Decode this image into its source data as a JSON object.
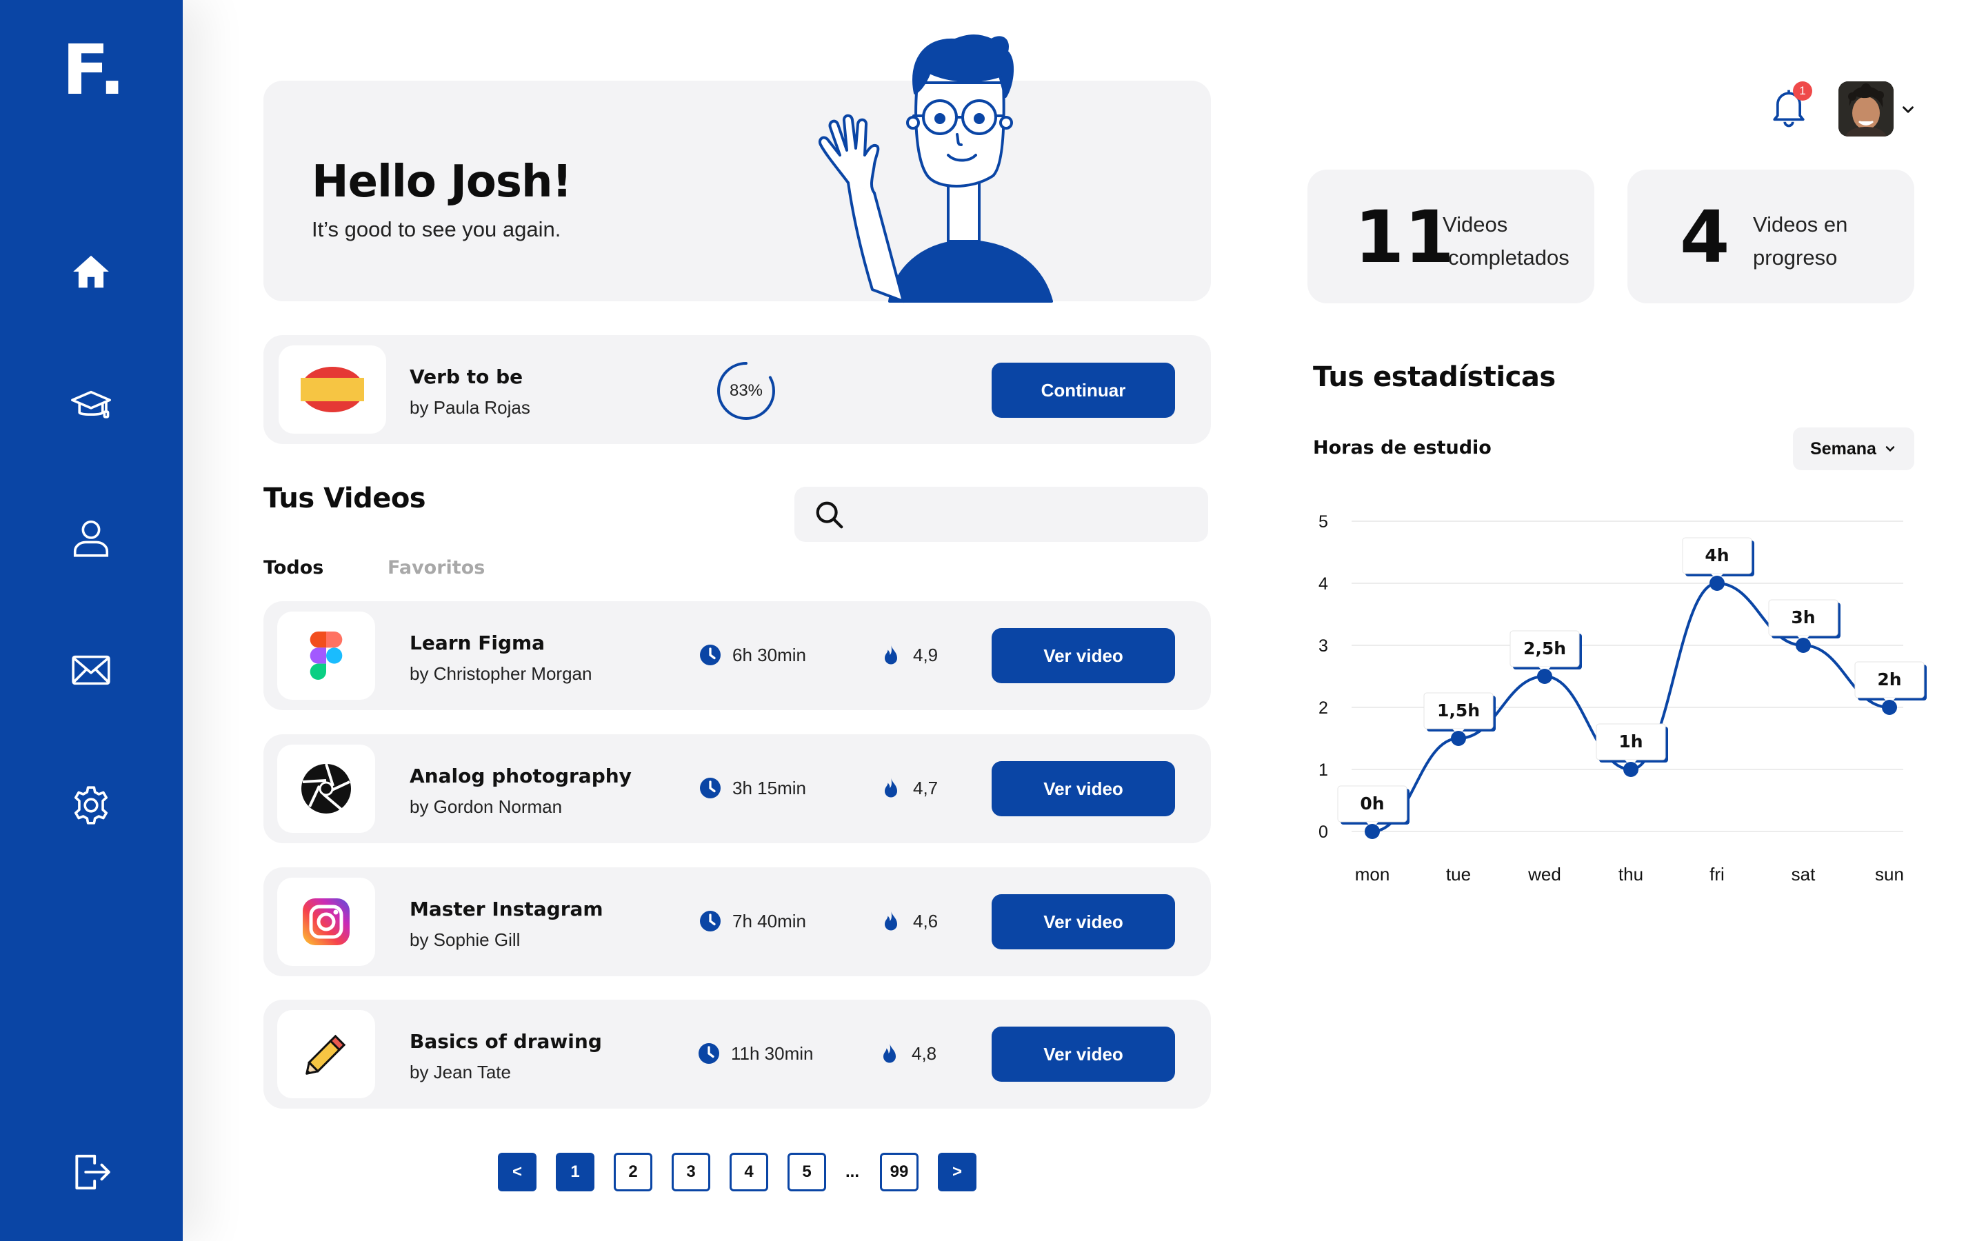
{
  "brand": {
    "logo": "F."
  },
  "sidebar": {
    "items": [
      {
        "icon": "home-icon",
        "label": "Inicio"
      },
      {
        "icon": "graduation-cap-icon",
        "label": "Cursos"
      },
      {
        "icon": "user-icon",
        "label": "Perfil"
      },
      {
        "icon": "mail-icon",
        "label": "Mensajes"
      },
      {
        "icon": "gear-icon",
        "label": "Ajustes"
      }
    ],
    "logout_icon": "logout-icon"
  },
  "hero": {
    "title": "Hello Josh!",
    "subtitle": "It’s good to see you again."
  },
  "in_progress": {
    "title": "Verb to be",
    "author": "by Paula Rojas",
    "progress_label": "83%",
    "progress": 0.83,
    "button": "Continuar"
  },
  "videos": {
    "title": "Tus Videos",
    "tabs": [
      {
        "label": "Todos"
      },
      {
        "label": "Favoritos"
      }
    ],
    "items": [
      {
        "title": "Learn Figma",
        "author": "by Christopher Morgan",
        "duration": "6h 30min",
        "rating": "4,9",
        "button": "Ver video",
        "icon": "figma-icon"
      },
      {
        "title": "Analog photography",
        "author": "by Gordon Norman",
        "duration": "3h 15min",
        "rating": "4,7",
        "button": "Ver video",
        "icon": "camera-aperture-icon"
      },
      {
        "title": "Master Instagram",
        "author": "by Sophie Gill",
        "duration": "7h 40min",
        "rating": "4,6",
        "button": "Ver video",
        "icon": "instagram-icon"
      },
      {
        "title": "Basics of drawing",
        "author": "by Jean Tate",
        "duration": "11h 30min",
        "rating": "4,8",
        "button": "Ver video",
        "icon": "pencil-icon"
      }
    ]
  },
  "pagination": {
    "prev": "<",
    "next": ">",
    "pages": [
      "1",
      "2",
      "3",
      "4",
      "5"
    ],
    "ellipsis": "...",
    "last": "99",
    "current": "1"
  },
  "header": {
    "notifications": "1"
  },
  "stats": {
    "completed": {
      "value": "11",
      "label_line1": "Videos",
      "label_line2": "completados"
    },
    "in_progress": {
      "value": "4",
      "label_line1": "Videos en",
      "label_line2": "progreso"
    }
  },
  "statistics": {
    "title": "Tus estadísticas",
    "subtitle": "Horas de estudio",
    "period": "Semana"
  },
  "chart_data": {
    "type": "line",
    "title": "Horas de estudio",
    "x": [
      "mon",
      "tue",
      "wed",
      "thu",
      "fri",
      "sat",
      "sun"
    ],
    "y_ticks": [
      "0",
      "1",
      "2",
      "3",
      "4",
      "5"
    ],
    "ylim": [
      0,
      5
    ],
    "grid": true,
    "series": [
      {
        "values": [
          0,
          1.5,
          2.5,
          1,
          4,
          3,
          2
        ],
        "labels": [
          "0h",
          "1,5h",
          "2,5h",
          "1h",
          "4h",
          "3h",
          "2h"
        ]
      }
    ],
    "color": "#0a45a5"
  },
  "colors": {
    "primary": "#0a45a5",
    "card": "#f3f3f5",
    "badge": "#ef4a4a",
    "tab_inactive": "#a8a8a8"
  }
}
